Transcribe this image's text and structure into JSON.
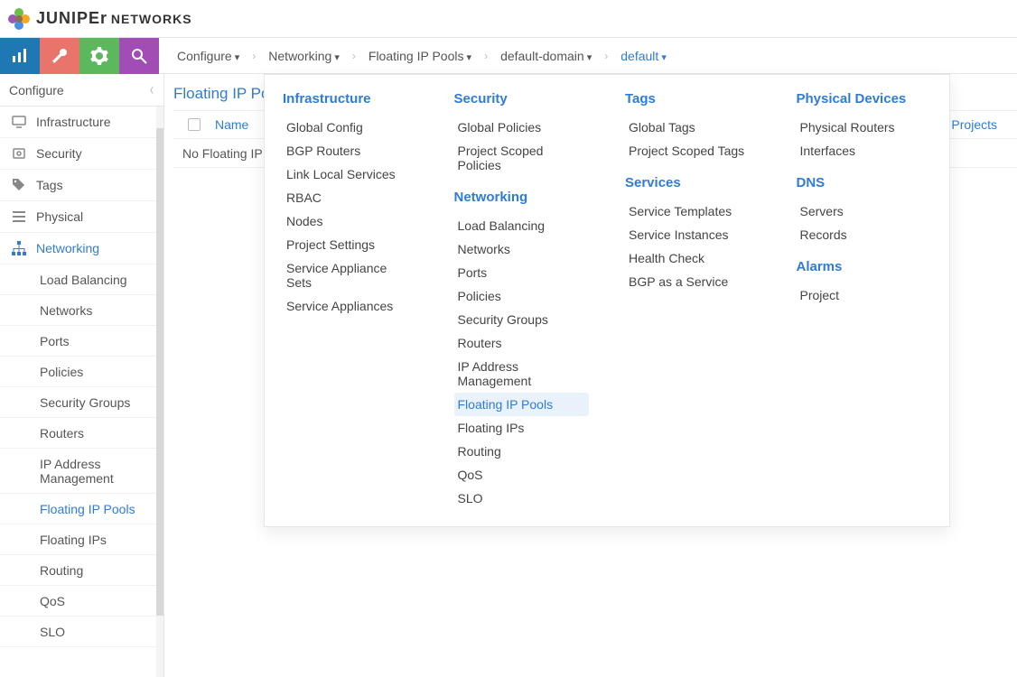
{
  "logo": {
    "brand": "JUNIPEr",
    "sub": "NETWORKS"
  },
  "breadcrumbs": {
    "items": [
      {
        "label": "Configure",
        "active": false
      },
      {
        "label": "Networking",
        "active": false
      },
      {
        "label": "Floating IP Pools",
        "active": false
      },
      {
        "label": "default-domain",
        "active": false
      },
      {
        "label": "default",
        "active": true
      }
    ]
  },
  "sidebar": {
    "header": "Configure",
    "items": [
      {
        "label": "Infrastructure",
        "icon": "monitor",
        "active": false,
        "sub": false
      },
      {
        "label": "Security",
        "icon": "shield",
        "active": false,
        "sub": false
      },
      {
        "label": "Tags",
        "icon": "tags",
        "active": false,
        "sub": false
      },
      {
        "label": "Physical",
        "icon": "bars",
        "active": false,
        "sub": false
      },
      {
        "label": "Networking",
        "icon": "sitemap",
        "active": true,
        "sub": false
      },
      {
        "label": "Load Balancing",
        "sub": true,
        "active": false
      },
      {
        "label": "Networks",
        "sub": true,
        "active": false
      },
      {
        "label": "Ports",
        "sub": true,
        "active": false
      },
      {
        "label": "Policies",
        "sub": true,
        "active": false
      },
      {
        "label": "Security Groups",
        "sub": true,
        "active": false
      },
      {
        "label": "Routers",
        "sub": true,
        "active": false
      },
      {
        "label": "IP Address Management",
        "sub": true,
        "active": false,
        "tall": true
      },
      {
        "label": "Floating IP Pools",
        "sub": true,
        "active": true
      },
      {
        "label": "Floating IPs",
        "sub": true,
        "active": false
      },
      {
        "label": "Routing",
        "sub": true,
        "active": false
      },
      {
        "label": "QoS",
        "sub": true,
        "active": false
      },
      {
        "label": "SLO",
        "sub": true,
        "active": false
      }
    ]
  },
  "page": {
    "title": "Floating IP Pools",
    "columns": {
      "name": "Name",
      "assoc": "Associated Projects"
    },
    "empty": "No Floating IP Pools Found."
  },
  "megamenu": {
    "cols": [
      {
        "sections": [
          {
            "heading": "Infrastructure",
            "items": [
              "Global Config",
              "BGP Routers",
              "Link Local Services",
              "RBAC",
              "Nodes",
              "Project Settings",
              "Service Appliance Sets",
              "Service Appliances"
            ]
          }
        ]
      },
      {
        "sections": [
          {
            "heading": "Security",
            "items": [
              "Global Policies",
              "Project Scoped Policies"
            ]
          },
          {
            "heading": "Networking",
            "items": [
              "Load Balancing",
              "Networks",
              "Ports",
              "Policies",
              "Security Groups",
              "Routers",
              "IP Address Management",
              "Floating IP Pools",
              "Floating IPs",
              "Routing",
              "QoS",
              "SLO"
            ]
          }
        ]
      },
      {
        "sections": [
          {
            "heading": "Tags",
            "items": [
              "Global Tags",
              "Project Scoped Tags"
            ]
          },
          {
            "heading": "Services",
            "items": [
              "Service Templates",
              "Service Instances",
              "Health Check",
              "BGP as a Service"
            ]
          }
        ]
      },
      {
        "sections": [
          {
            "heading": "Physical Devices",
            "items": [
              "Physical Routers",
              "Interfaces"
            ]
          },
          {
            "heading": "DNS",
            "items": [
              "Servers",
              "Records"
            ]
          },
          {
            "heading": "Alarms",
            "items": [
              "Project"
            ]
          }
        ]
      }
    ],
    "selected": "Floating IP Pools"
  }
}
